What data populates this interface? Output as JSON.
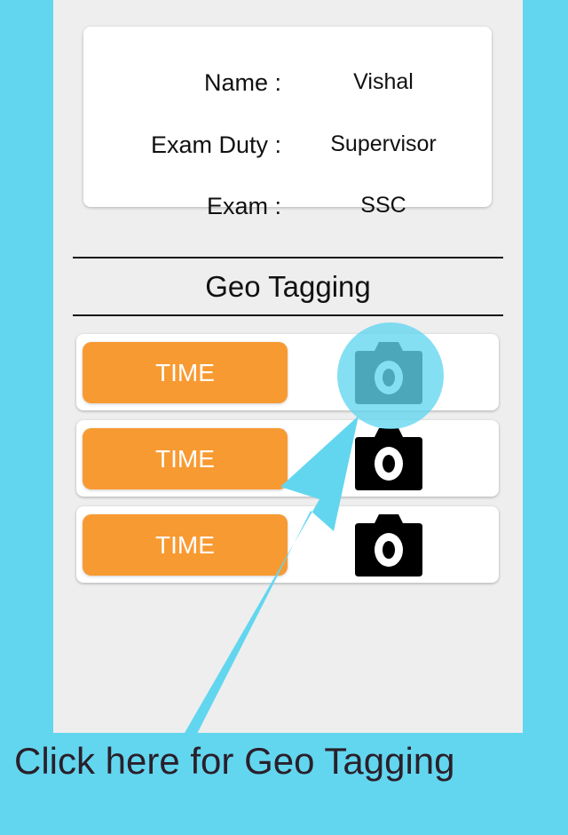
{
  "profile": {
    "name_label": "Name :",
    "name_value": "Vishal",
    "duty_label": "Exam Duty :",
    "duty_value": "Supervisor",
    "exam_label": "Exam :",
    "exam_value": "SSC"
  },
  "geo_tagging": {
    "title": "Geo Tagging",
    "rows": [
      {
        "button_label": "TIME",
        "icon": "camera-icon",
        "highlighted": true
      },
      {
        "button_label": "TIME",
        "icon": "camera-icon",
        "highlighted": false
      },
      {
        "button_label": "TIME",
        "icon": "camera-icon",
        "highlighted": false
      }
    ]
  },
  "tutorial": {
    "caption": "Click here for Geo Tagging",
    "overlay_color": "#62d6ef"
  },
  "colors": {
    "background": "#62d6ef",
    "screen": "#eeeeee",
    "time_button": "#f89a32"
  }
}
